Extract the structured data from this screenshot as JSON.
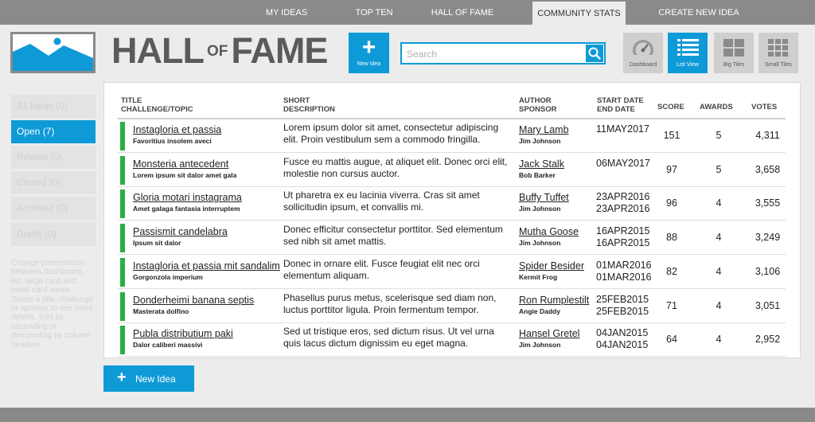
{
  "nav": {
    "tabs": [
      {
        "label": "MY IDEAS"
      },
      {
        "label": "TOP TEN"
      },
      {
        "label": "HALL OF FAME"
      },
      {
        "label": "COMMUNITY STATS"
      },
      {
        "label": "CREATE NEW IDEA"
      }
    ],
    "active_tab": "COMMUNITY STATS"
  },
  "header": {
    "title_part1": "HALL",
    "title_of": "OF",
    "title_part2": "FAME",
    "new_idea_label": "New Idea",
    "search_placeholder": "Search",
    "views": [
      {
        "label": "Dashboard",
        "icon": "gauge-icon"
      },
      {
        "label": "List View",
        "icon": "list-icon"
      },
      {
        "label": "Big Tiles",
        "icon": "big-tiles-icon"
      },
      {
        "label": "Small Tiles",
        "icon": "small-tiles-icon"
      }
    ],
    "active_view": "List View"
  },
  "sidebar": {
    "items": [
      {
        "label": "All Ideas (0)"
      },
      {
        "label": "Open (7)"
      },
      {
        "label": "Review (0)"
      },
      {
        "label": "Closed (0)"
      },
      {
        "label": "Archived (0)"
      },
      {
        "label": "Drafts (0)"
      }
    ],
    "active": "Open (7)",
    "help_text": "Change presentation between dashboard, list, large card and small card views. Select a title, challenge or sponsor to see more details. Sort by ascending or descending by column headers."
  },
  "table": {
    "headers": {
      "title_1": "TITLE",
      "title_2": "CHALLENGE/TOPIC",
      "desc_1": "SHORT",
      "desc_2": "DESCRIPTION",
      "author_1": "AUTHOR",
      "author_2": "SPONSOR",
      "date_1": "START DATE",
      "date_2": "END DATE",
      "score": "SCORE",
      "awards": "AWARDS",
      "votes": "VOTES"
    },
    "rows": [
      {
        "title": "Instagloria et passia",
        "topic": "Favoritius insolem aveci",
        "description": "Lorem ipsum dolor sit amet, consectetur adipiscing elit. Proin vestibulum sem a commodo fringilla.",
        "author": "Mary Lamb",
        "sponsor": "Jim Johnson",
        "start": "11MAY2017",
        "end": "",
        "score": "151",
        "awards": "5",
        "votes": "4,311"
      },
      {
        "title": "Monsteria antecedent",
        "topic": "Lorem ipsum sit dalor amet gala",
        "description": "Fusce eu mattis augue, at aliquet elit. Donec orci elit, molestie non cursus auctor.",
        "author": "Jack Stalk",
        "sponsor": "Bob Barker",
        "start": "06MAY2017",
        "end": "",
        "score": "97",
        "awards": "5",
        "votes": "3,658"
      },
      {
        "title": "Gloria motari instagrama",
        "topic": "Amet galaga fantasia interruptem",
        "description": "Ut pharetra ex eu lacinia viverra. Cras sit amet sollicitudin ipsum, et convallis mi.",
        "author": "Buffy Tuffet",
        "sponsor": "Jim Johnson",
        "start": "23APR2016",
        "end": "23APR2016",
        "score": "96",
        "awards": "4",
        "votes": "3,555"
      },
      {
        "title": "Passismit candelabra",
        "topic": "Ipsum sit dalor",
        "description": "Donec efficitur consectetur porttitor. Sed elementum sed nibh sit amet mattis.",
        "author": "Mutha Goose",
        "sponsor": "Jim Johnson",
        "start": "16APR2015",
        "end": "16APR2015",
        "score": "88",
        "awards": "4",
        "votes": "3,249"
      },
      {
        "title": "Instagloria et passia mit sandalim",
        "topic": "Gorgonzola imperium",
        "description": "Donec in ornare elit. Fusce feugiat elit nec orci elementum aliquam.",
        "author": "Spider Besider",
        "sponsor": "Kermit Frog",
        "start": "01MAR2016",
        "end": "01MAR2016",
        "score": "82",
        "awards": "4",
        "votes": "3,106"
      },
      {
        "title": "Donderheimi banana septis",
        "topic": "Masterata dolfino",
        "description": "Phasellus purus metus, scelerisque sed diam non, luctus porttitor ligula. Proin fermentum tempor.",
        "author": "Ron Rumplestilt",
        "sponsor": "Angie Daddy",
        "start": "25FEB2015",
        "end": "25FEB2015",
        "score": "71",
        "awards": "4",
        "votes": "3,051"
      },
      {
        "title": "Publa distributium paki",
        "topic": "Dalor caliberi massivi",
        "description": "Sed ut tristique eros, sed dictum risus. Ut vel urna quis lacus dictum dignissim eu eget magna.",
        "author": "Hansel Gretel",
        "sponsor": "Jim Johnson",
        "start": "04JAN2015",
        "end": "04JAN2015",
        "score": "64",
        "awards": "4",
        "votes": "2,952"
      }
    ]
  },
  "bottom": {
    "new_idea_label": "New Idea"
  },
  "colors": {
    "accent": "#0e9ad7",
    "status_green": "#29b042",
    "nav_gray": "#8a8a8a"
  }
}
